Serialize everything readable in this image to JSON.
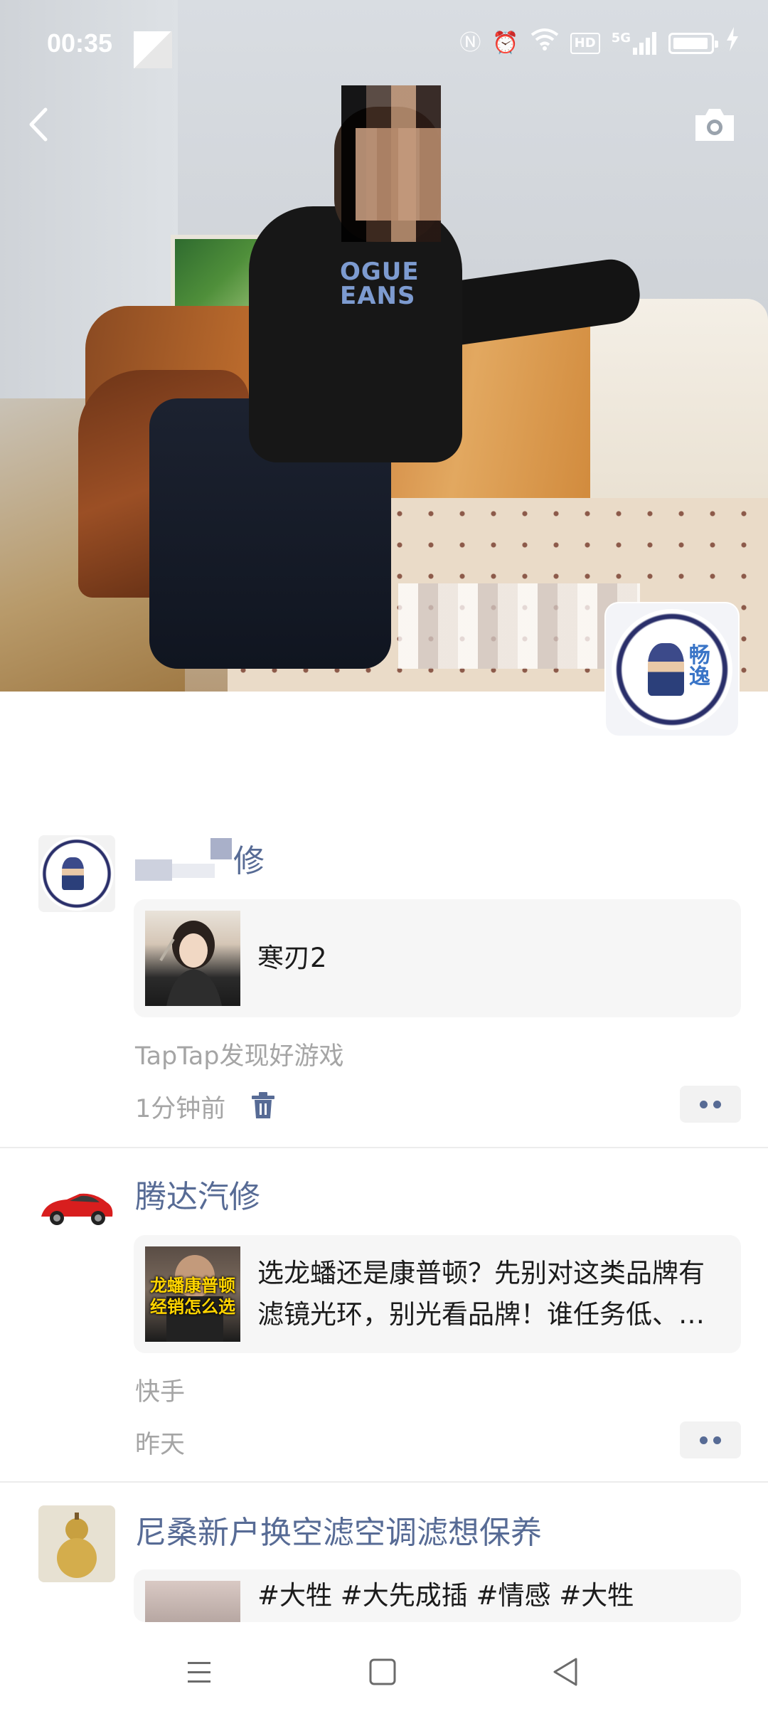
{
  "status_bar": {
    "time": "00:35",
    "icons": [
      "nfc-icon",
      "alarm-icon",
      "wifi-icon",
      "hd-icon",
      "5g-signal-icon",
      "battery-icon",
      "charging-icon"
    ],
    "hd_label": "HD",
    "network_label": "5G"
  },
  "cover": {
    "shirt_text": "OGUE EANS"
  },
  "profile": {
    "avatar_badge_text": "畅逸"
  },
  "feed": [
    {
      "name_suffix": "修",
      "card_title": "寒刃2",
      "source": "TapTap发现好游戏",
      "time": "1分钟前"
    },
    {
      "name": "腾达汽修",
      "card_thumb_text": "龙蟠康普顿 经销怎么选",
      "card_title": "选龙蟠还是康普顿？先别对这类品牌有滤镜光环，别光看品牌！谁任务低、…",
      "source": "快手",
      "time": "昨天"
    },
    {
      "name": "尼桑新户换空滤空调滤想保养",
      "card_title": "#大牲 #大先成插 #情感 #大牲"
    }
  ],
  "colors": {
    "link_blue": "#576b95",
    "meta_gray": "#a5a5a5",
    "card_bg": "#f6f6f6"
  }
}
